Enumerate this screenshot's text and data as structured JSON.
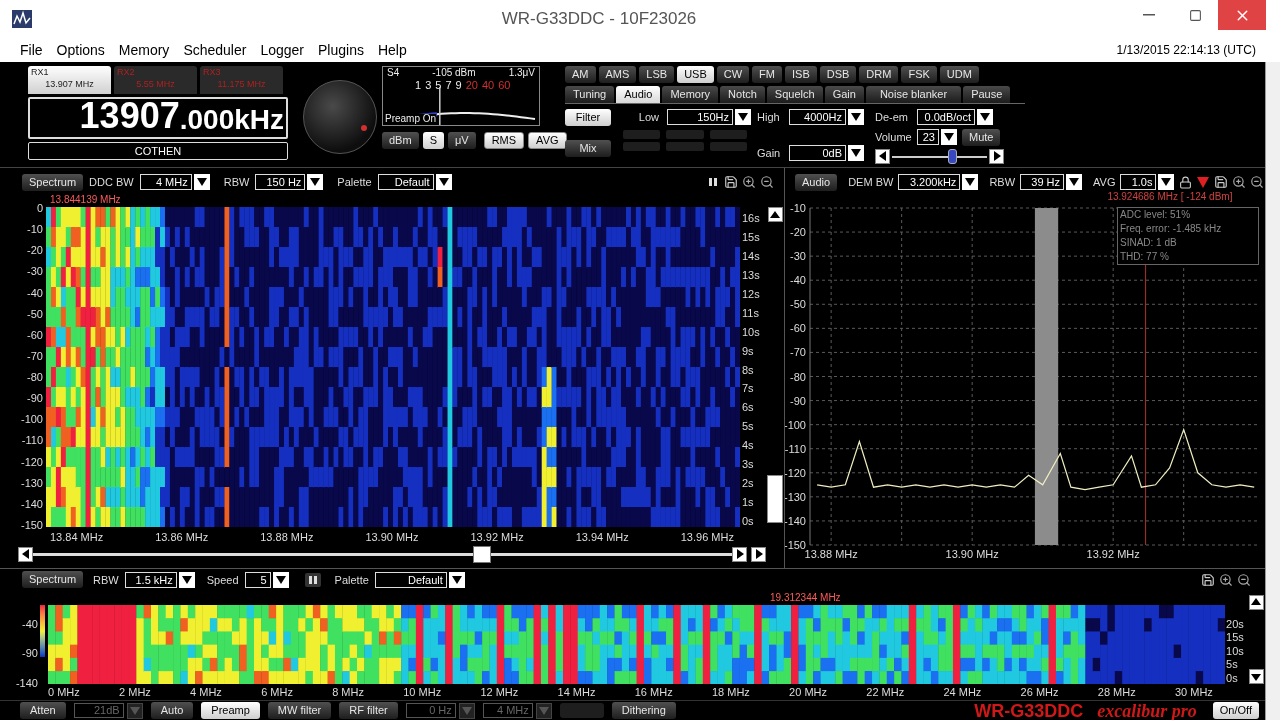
{
  "window": {
    "title": "WR-G33DDC - 10F23026"
  },
  "menu": [
    "File",
    "Options",
    "Memory",
    "Scheduler",
    "Logger",
    "Plugins",
    "Help"
  ],
  "datetime": "1/13/2015 22:14:13 (UTC)",
  "receivers": [
    {
      "name": "RX1",
      "freq": "13.907 MHz",
      "selected": true
    },
    {
      "name": "RX2",
      "freq": "5.55 MHz",
      "selected": false
    },
    {
      "name": "RX3",
      "freq": "11.175 MHz",
      "selected": false
    }
  ],
  "frequency": {
    "main": "13907",
    "fraction": ".000kHz"
  },
  "station": "COTHEN",
  "smeter": {
    "s": "S4",
    "dbm": "-105 dBm",
    "uv": "1.3μV",
    "note": "Preamp On",
    "level": 0.32,
    "scale": [
      {
        "label": "1",
        "over": false
      },
      {
        "label": "3",
        "over": false
      },
      {
        "label": "5",
        "over": false
      },
      {
        "label": "7",
        "over": false
      },
      {
        "label": "9",
        "over": false
      },
      {
        "label": "20",
        "over": true
      },
      {
        "label": "40",
        "over": true
      },
      {
        "label": "60",
        "over": true
      }
    ],
    "units": [
      {
        "label": "dBm",
        "selected": false
      },
      {
        "label": "S",
        "selected": true
      },
      {
        "label": "μV",
        "selected": false
      }
    ],
    "options": [
      {
        "label": "RMS",
        "on": true
      },
      {
        "label": "AVG",
        "on": true
      }
    ]
  },
  "modes": [
    {
      "label": "AM",
      "selected": false
    },
    {
      "label": "AMS",
      "selected": false
    },
    {
      "label": "LSB",
      "selected": false
    },
    {
      "label": "USB",
      "selected": true
    },
    {
      "label": "CW",
      "selected": false
    },
    {
      "label": "FM",
      "selected": false
    },
    {
      "label": "ISB",
      "selected": false
    },
    {
      "label": "DSB",
      "selected": false
    },
    {
      "label": "DRM",
      "selected": false
    },
    {
      "label": "FSK",
      "selected": false
    },
    {
      "label": "UDM",
      "selected": false
    }
  ],
  "tabs": [
    {
      "label": "Tuning",
      "selected": false
    },
    {
      "label": "Audio",
      "selected": true
    },
    {
      "label": "Memory",
      "selected": false
    },
    {
      "label": "Notch",
      "selected": false
    },
    {
      "label": "Squelch",
      "selected": false
    },
    {
      "label": "Gain",
      "selected": false
    },
    {
      "label": "Noise blanker",
      "selected": false
    },
    {
      "label": "Pause",
      "selected": false
    }
  ],
  "audio": {
    "buttons": [
      {
        "label": "Filter",
        "selected": true
      },
      {
        "label": "Mix",
        "selected": false
      }
    ],
    "low_label": "Low",
    "low": "150Hz",
    "high_label": "High",
    "high": "4000Hz",
    "deem_label": "De-em",
    "deem": "0.0dB/oct",
    "volume_label": "Volume",
    "volume": "23",
    "mute": "Mute",
    "gain_label": "Gain",
    "gain": "0dB",
    "level": 0.63
  },
  "spectrum": {
    "button": "Spectrum",
    "ddc_label": "DDC BW",
    "ddc": "4 MHz",
    "rbw_label": "RBW",
    "rbw": "150 Hz",
    "palette_label": "Palette",
    "palette": "Default",
    "marker": "13.844139 MHz",
    "y_labels": [
      "0",
      "-10",
      "-20",
      "-30",
      "-40",
      "-50",
      "-60",
      "-70",
      "-80",
      "-90",
      "-100",
      "-110",
      "-120",
      "-130",
      "-140",
      "-150"
    ],
    "time_labels": [
      "16s",
      "15s",
      "14s",
      "13s",
      "12s",
      "11s",
      "10s",
      "9s",
      "8s",
      "7s",
      "6s",
      "5s",
      "4s",
      "3s",
      "2s",
      "1s",
      "0s"
    ],
    "x_labels": [
      "13.84 MHz",
      "13.86 MHz",
      "13.88 MHz",
      "13.90 MHz",
      "13.92 MHz",
      "13.94 MHz",
      "13.96 MHz"
    ]
  },
  "audio_spectrum": {
    "button": "Audio",
    "dem_label": "DEM BW",
    "dem": "3.200kHz",
    "rbw_label": "RBW",
    "rbw": "39 Hz",
    "avg_label": "AVG",
    "avg": "1.0s",
    "marker": "13.924686 MHz [ -124 dBm]",
    "info": [
      "ADC level: 51%",
      "Freq. error: -1.485 kHz",
      "SINAD: 1 dB",
      "THD: 77 %"
    ],
    "chart_data": {
      "type": "line",
      "xlim": [
        13.877,
        13.9404
      ],
      "ylim": [
        -150,
        -10
      ],
      "xticks": [
        {
          "value": 13.88,
          "label": "13.88 MHz"
        },
        {
          "value": 13.9,
          "label": "13.90 MHz"
        },
        {
          "value": 13.92,
          "label": "13.92 MHz"
        }
      ],
      "yticks": [
        -10,
        -20,
        -30,
        -40,
        -50,
        -60,
        -70,
        -80,
        -90,
        -100,
        -110,
        -120,
        -130,
        -140,
        -150
      ],
      "x": [
        13.878,
        13.88,
        13.882,
        13.884,
        13.886,
        13.888,
        13.89,
        13.892,
        13.894,
        13.896,
        13.898,
        13.9,
        13.902,
        13.904,
        13.906,
        13.908,
        13.91,
        13.9125,
        13.914,
        13.916,
        13.918,
        13.92,
        13.9226,
        13.924,
        13.926,
        13.928,
        13.93,
        13.932,
        13.934,
        13.936,
        13.938,
        13.94
      ],
      "grid": true,
      "series": [
        {
          "color": "#f0eec0",
          "values": [
            -125,
            -126,
            -125,
            -107,
            -126,
            -125,
            -126,
            -125,
            -126,
            -125,
            -126,
            -125,
            -126,
            -125,
            -126,
            -121,
            -125,
            -112,
            -126,
            -127,
            -126,
            -125,
            -113,
            -126,
            -125,
            -118,
            -102,
            -120,
            -125,
            -126,
            -125,
            -126
          ]
        }
      ],
      "bands": [
        {
          "axis": "x",
          "from": 13.9089,
          "to": 13.9122
        }
      ],
      "ref_lines": [
        {
          "axis": "x",
          "value": 13.9246
        }
      ]
    }
  },
  "wideband": {
    "button": "Spectrum",
    "rbw_label": "RBW",
    "rbw": "1.5 kHz",
    "speed_label": "Speed",
    "speed": "5",
    "palette_label": "Palette",
    "palette": "Default",
    "marker": "19.312344 MHz",
    "y_labels": [
      "-40",
      "-90",
      "-140"
    ],
    "time_labels": [
      "20s",
      "15s",
      "10s",
      "5s",
      "0s"
    ],
    "x_labels": [
      "0 MHz",
      "2 MHz",
      "4 MHz",
      "6 MHz",
      "8 MHz",
      "10 MHz",
      "12 MHz",
      "14 MHz",
      "16 MHz",
      "18 MHz",
      "20 MHz",
      "22 MHz",
      "24 MHz",
      "26 MHz",
      "28 MHz",
      "30 MHz"
    ]
  },
  "bottom_bar": [
    {
      "kind": "button",
      "label": "Atten",
      "selected": false
    },
    {
      "kind": "field",
      "value": "21dB",
      "disabled": true
    },
    {
      "kind": "button",
      "label": "Auto",
      "selected": false
    },
    {
      "kind": "button",
      "label": "Preamp",
      "selected": true
    },
    {
      "kind": "button",
      "label": "MW filter",
      "selected": false
    },
    {
      "kind": "button",
      "label": "RF filter",
      "selected": false
    },
    {
      "kind": "field",
      "value": "0 Hz",
      "disabled": true
    },
    {
      "kind": "field",
      "value": "4 MHz",
      "disabled": true
    },
    {
      "kind": "blank"
    },
    {
      "kind": "button",
      "label": "Dithering",
      "selected": false
    }
  ],
  "brand": {
    "model": "WR-G33DDC",
    "edition": "excalibur pro"
  },
  "power": "On/Off"
}
